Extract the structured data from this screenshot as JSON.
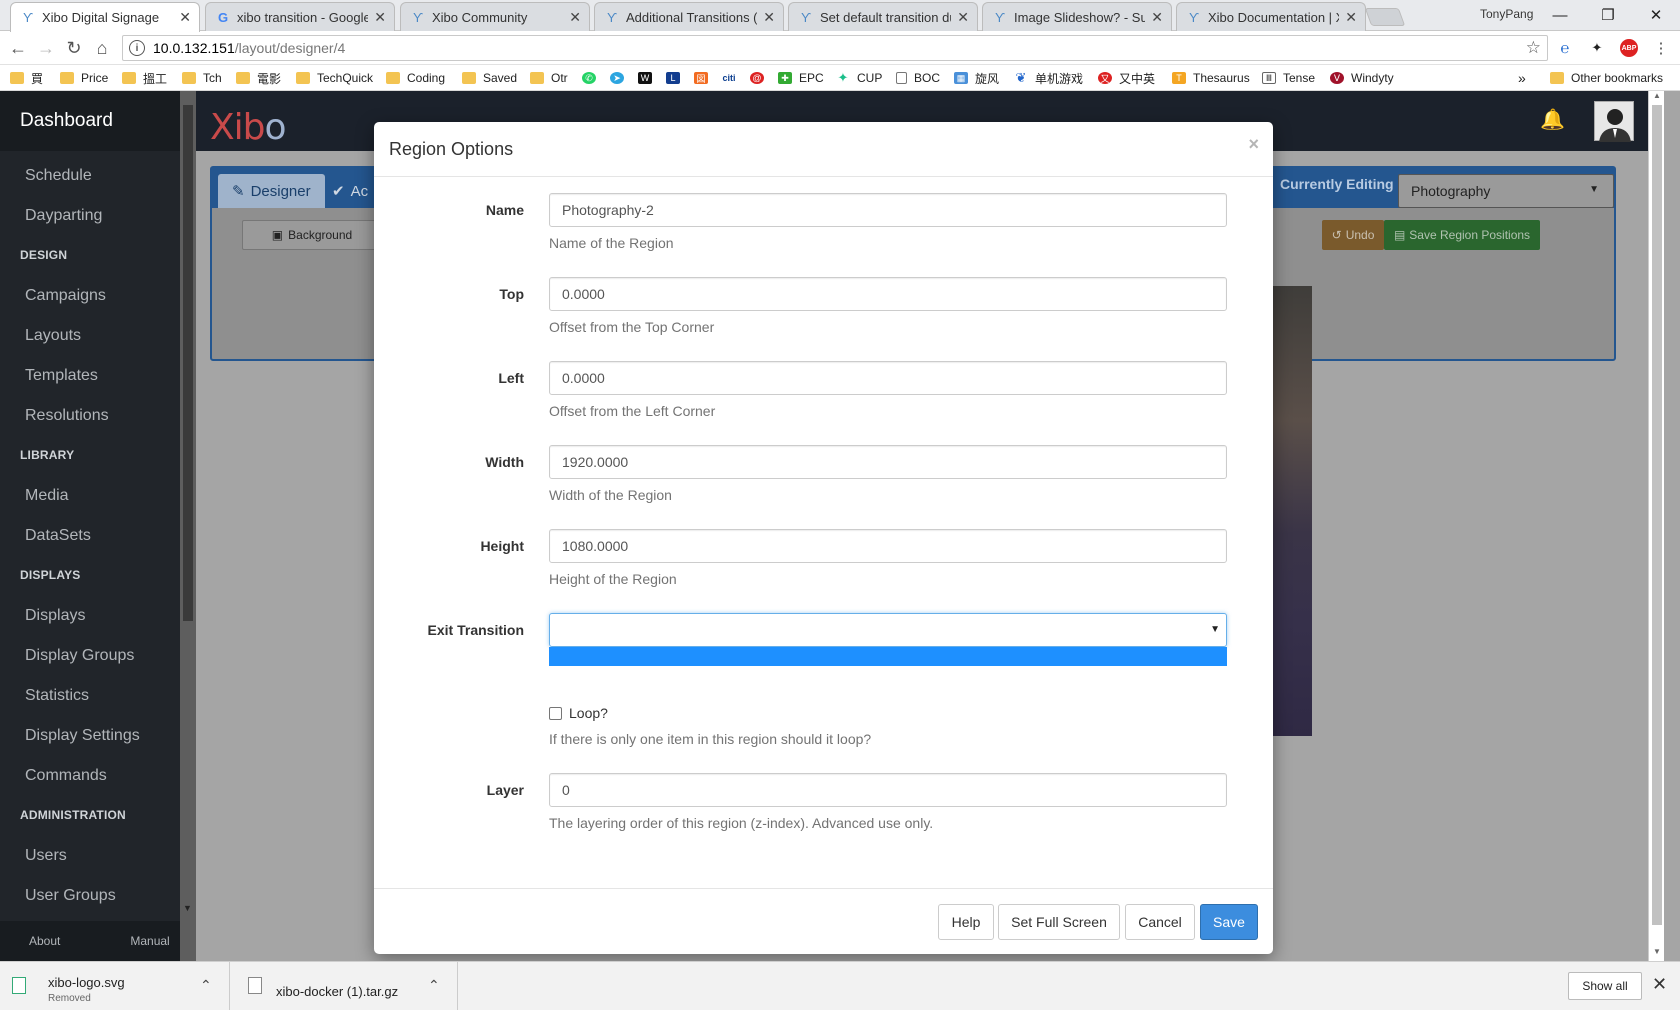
{
  "browser": {
    "tabs": [
      {
        "title": "Xibo Digital Signage",
        "favicon": "xibo-icon",
        "active": true
      },
      {
        "title": "xibo transition - Google S",
        "favicon": "google-icon",
        "active": false
      },
      {
        "title": "Xibo Community",
        "favicon": "xibo-icon",
        "active": false
      },
      {
        "title": "Additional Transitions (C",
        "favicon": "xibo-icon",
        "active": false
      },
      {
        "title": "Set default transition du",
        "favicon": "xibo-icon",
        "active": false
      },
      {
        "title": "Image Slideshow? - Supp",
        "favicon": "xibo-icon",
        "active": false
      },
      {
        "title": "Xibo Documentation | Xil",
        "favicon": "xibo-icon",
        "active": false
      }
    ],
    "profile_name": "TonyPang",
    "url_host": "10.0.132.151",
    "url_path": "/layout/designer/4",
    "bookmarks": [
      {
        "label": "買",
        "icon": "folder-icon"
      },
      {
        "label": "Price",
        "icon": "folder-icon"
      },
      {
        "label": "搵工",
        "icon": "folder-icon"
      },
      {
        "label": "Tch",
        "icon": "folder-icon"
      },
      {
        "label": "電影",
        "icon": "folder-icon"
      },
      {
        "label": "TechQuick",
        "icon": "folder-icon"
      },
      {
        "label": "Coding",
        "icon": "folder-icon"
      },
      {
        "label": "Saved",
        "icon": "folder-icon"
      },
      {
        "label": "Otr",
        "icon": "folder-icon"
      },
      {
        "label": "",
        "icon": "whatsapp-icon"
      },
      {
        "label": "",
        "icon": "telegram-icon"
      },
      {
        "label": "",
        "icon": "w-icon"
      },
      {
        "label": "",
        "icon": "l-icon"
      },
      {
        "label": "",
        "icon": "app-icon"
      },
      {
        "label": "",
        "icon": "citi-icon"
      },
      {
        "label": "",
        "icon": "red-icon"
      },
      {
        "label": "EPC",
        "icon": "epc-icon"
      },
      {
        "label": "CUP",
        "icon": "cup-icon"
      },
      {
        "label": "BOC",
        "icon": "page-icon"
      },
      {
        "label": "旋风",
        "icon": "grid-icon"
      },
      {
        "label": "单机游戏",
        "icon": "feather-icon"
      },
      {
        "label": "又中英",
        "icon": "red-icon"
      },
      {
        "label": "Thesaurus",
        "icon": "thesaurus-icon"
      },
      {
        "label": "Tense",
        "icon": "book-icon"
      },
      {
        "label": "Windyty",
        "icon": "windy-icon"
      }
    ],
    "other_bookmarks": "Other bookmarks",
    "overflow_chevron": "»"
  },
  "sidebar": {
    "brand": "Dashboard",
    "sections": [
      {
        "type": "item",
        "label": "Schedule"
      },
      {
        "type": "item",
        "label": "Dayparting"
      },
      {
        "type": "heading",
        "label": "DESIGN"
      },
      {
        "type": "item",
        "label": "Campaigns"
      },
      {
        "type": "item",
        "label": "Layouts"
      },
      {
        "type": "item",
        "label": "Templates"
      },
      {
        "type": "item",
        "label": "Resolutions"
      },
      {
        "type": "heading",
        "label": "LIBRARY"
      },
      {
        "type": "item",
        "label": "Media"
      },
      {
        "type": "item",
        "label": "DataSets"
      },
      {
        "type": "heading",
        "label": "DISPLAYS"
      },
      {
        "type": "item",
        "label": "Displays"
      },
      {
        "type": "item",
        "label": "Display Groups"
      },
      {
        "type": "item",
        "label": "Statistics"
      },
      {
        "type": "item",
        "label": "Display Settings"
      },
      {
        "type": "item",
        "label": "Commands"
      },
      {
        "type": "heading",
        "label": "ADMINISTRATION"
      },
      {
        "type": "item",
        "label": "Users"
      },
      {
        "type": "item",
        "label": "User Groups"
      }
    ],
    "footer_about": "About",
    "footer_manual": "Manual"
  },
  "header": {
    "logo_x": "X",
    "logo_ib": "ib",
    "logo_o": "o"
  },
  "designer": {
    "tab_designer": "Designer",
    "tab_actions": "Ac",
    "background_button": "Background",
    "currently_editing_label": "Currently Editing",
    "currently_editing_value": "Photography",
    "undo_button": "Undo",
    "save_region_positions": "Save Region Positions"
  },
  "modal": {
    "title": "Region Options",
    "close": "×",
    "fields": {
      "name": {
        "label": "Name",
        "value": "Photography-2",
        "help": "Name of the Region"
      },
      "top": {
        "label": "Top",
        "value": "0.0000",
        "help": "Offset from the Top Corner"
      },
      "left": {
        "label": "Left",
        "value": "0.0000",
        "help": "Offset from the Left Corner"
      },
      "width": {
        "label": "Width",
        "value": "1920.0000",
        "help": "Width of the Region"
      },
      "height": {
        "label": "Height",
        "value": "1080.0000",
        "help": "Height of the Region"
      },
      "exit_transition": {
        "label": "Exit Transition",
        "value": ""
      },
      "loop": {
        "label": "Loop?",
        "help": "If there is only one item in this region should it loop?",
        "checked": false
      },
      "layer": {
        "label": "Layer",
        "value": "0",
        "help": "The layering order of this region (z-index). Advanced use only."
      }
    },
    "buttons": {
      "help": "Help",
      "set_full_screen": "Set Full Screen",
      "cancel": "Cancel",
      "save": "Save"
    }
  },
  "downloads": {
    "items": [
      {
        "name": "xibo-logo.svg",
        "status": "Removed"
      },
      {
        "name": "xibo-docker (1).tar.gz",
        "status": ""
      }
    ],
    "show_all": "Show all"
  },
  "colors": {
    "sidebar_bg": "#21252a",
    "primary_button": "#3c8dde",
    "dropdown_highlight": "#1e90ff",
    "designer_accent": "#24568f"
  }
}
